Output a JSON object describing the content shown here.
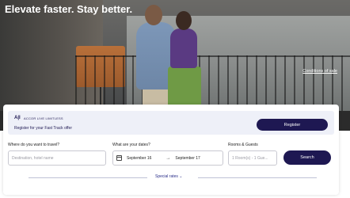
{
  "hero": {
    "headline": "Elevate faster. Stay better.",
    "conditions_link": "Conditions of sale"
  },
  "promo": {
    "logo": "A|I",
    "brand": "ACCOR LIVE LIMITLESS",
    "text": "Register for your Fast Track offer",
    "register_label": "Register"
  },
  "booking": {
    "destination_label": "Where do you want to travel?",
    "destination_placeholder": "Destination, hotel name",
    "dates_label": "What are your dates?",
    "checkin": "September 16",
    "checkout": "September 17",
    "rooms_label": "Rooms & Guests",
    "rooms_value": "1 Room(s) - 1 Gue...",
    "search_label": "Search",
    "special_rates": "Special rates"
  },
  "colors": {
    "brand": "#1e1852",
    "promo_bg": "#eef0f8"
  }
}
